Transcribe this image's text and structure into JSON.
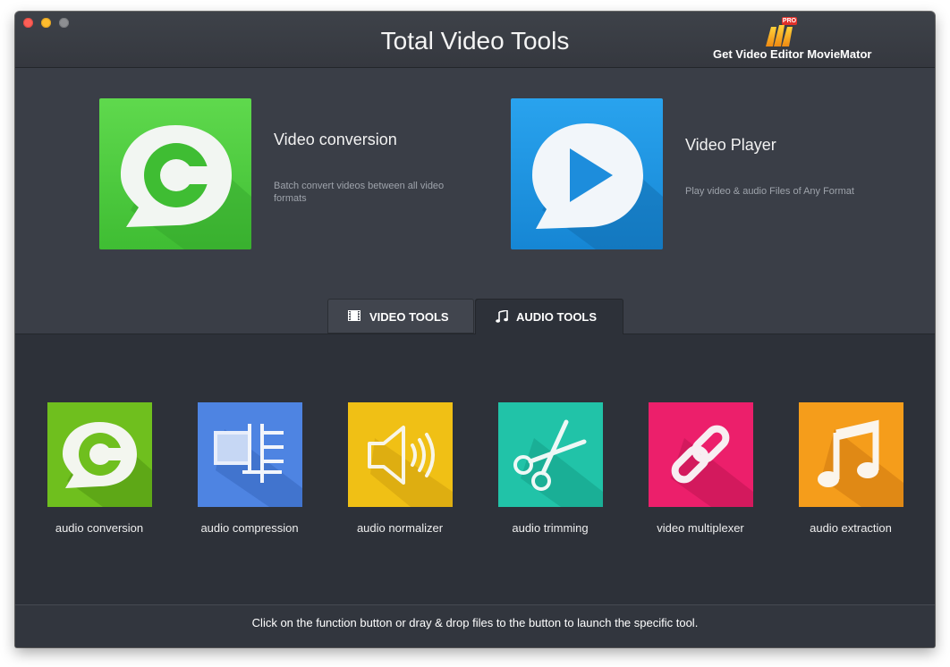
{
  "window": {
    "title": "Total Video Tools"
  },
  "promo": {
    "label": "Get Video Editor MovieMator",
    "badge": "PRO",
    "icon": "moviemator-logo-icon"
  },
  "hero": [
    {
      "title": "Video conversion",
      "description": "Batch convert videos between all video formats",
      "icon": "video-conversion-icon",
      "color": "#4fcf42"
    },
    {
      "title": "Video Player",
      "description": "Play video & audio Files of Any Format",
      "icon": "play-icon",
      "color": "#1f93e0"
    }
  ],
  "tabs": [
    {
      "label": "VIDEO TOOLS",
      "icon": "film-icon",
      "active": false
    },
    {
      "label": "AUDIO TOOLS",
      "icon": "music-note-icon",
      "active": true
    }
  ],
  "tools": [
    {
      "label": "audio conversion",
      "icon": "audio-conversion-icon",
      "color": "#6fbf1e"
    },
    {
      "label": "audio compression",
      "icon": "compression-icon",
      "color": "#4e84e2"
    },
    {
      "label": "audio normalizer",
      "icon": "speaker-icon",
      "color": "#f0c015"
    },
    {
      "label": "audio trimming",
      "icon": "scissors-icon",
      "color": "#21c3a8"
    },
    {
      "label": "video multiplexer",
      "icon": "link-icon",
      "color": "#ec1f6b"
    },
    {
      "label": "audio extraction",
      "icon": "music-note-icon",
      "color": "#f59d1b"
    }
  ],
  "footer": {
    "hint": "Click on the function button or dray & drop files to the button to launch the specific tool."
  }
}
